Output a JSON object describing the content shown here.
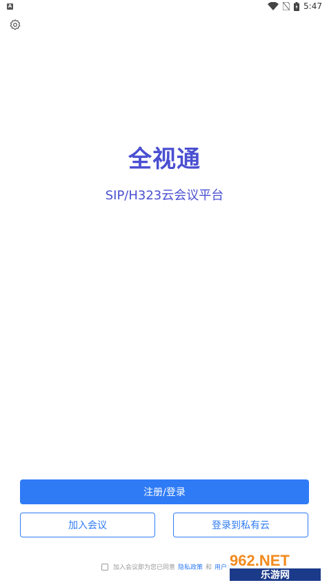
{
  "status_bar": {
    "left_icon_letter": "A",
    "time": "5:47"
  },
  "header": {
    "settings_icon": "gear-icon"
  },
  "brand": {
    "title": "全视通",
    "subtitle": "SIP/H323云会议平台",
    "color": "#4a4fd1"
  },
  "actions": {
    "register_login": "注册/登录",
    "join_meeting": "加入会议",
    "private_cloud_login": "登录到私有云",
    "accent": "#2f7bf6"
  },
  "agreement": {
    "prefix": "加入会议即为您已同意",
    "privacy_policy": "隐私政策",
    "and": "和",
    "user_agreement": "用户协议"
  },
  "watermark": {
    "top": "962.NET",
    "bottom": "乐游网"
  }
}
